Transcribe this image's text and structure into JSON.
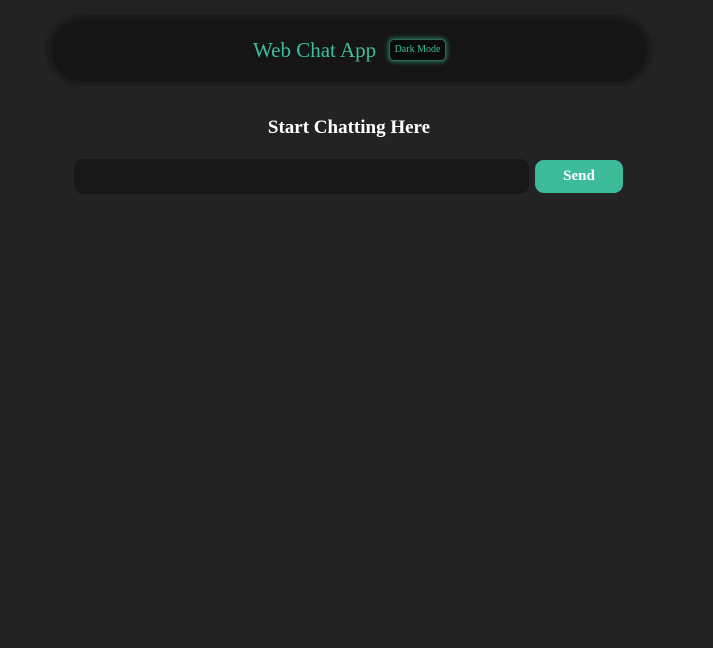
{
  "header": {
    "title": "Web Chat App",
    "mode_toggle_label": "Dark Mode"
  },
  "main": {
    "heading": "Start Chatting Here",
    "message_input": {
      "value": "",
      "placeholder": ""
    },
    "send_label": "Send"
  },
  "colors": {
    "background": "#232323",
    "header_background": "#151515",
    "accent": "#3dbd9a",
    "input_background": "#181818",
    "send_button": "#3bbb98"
  }
}
